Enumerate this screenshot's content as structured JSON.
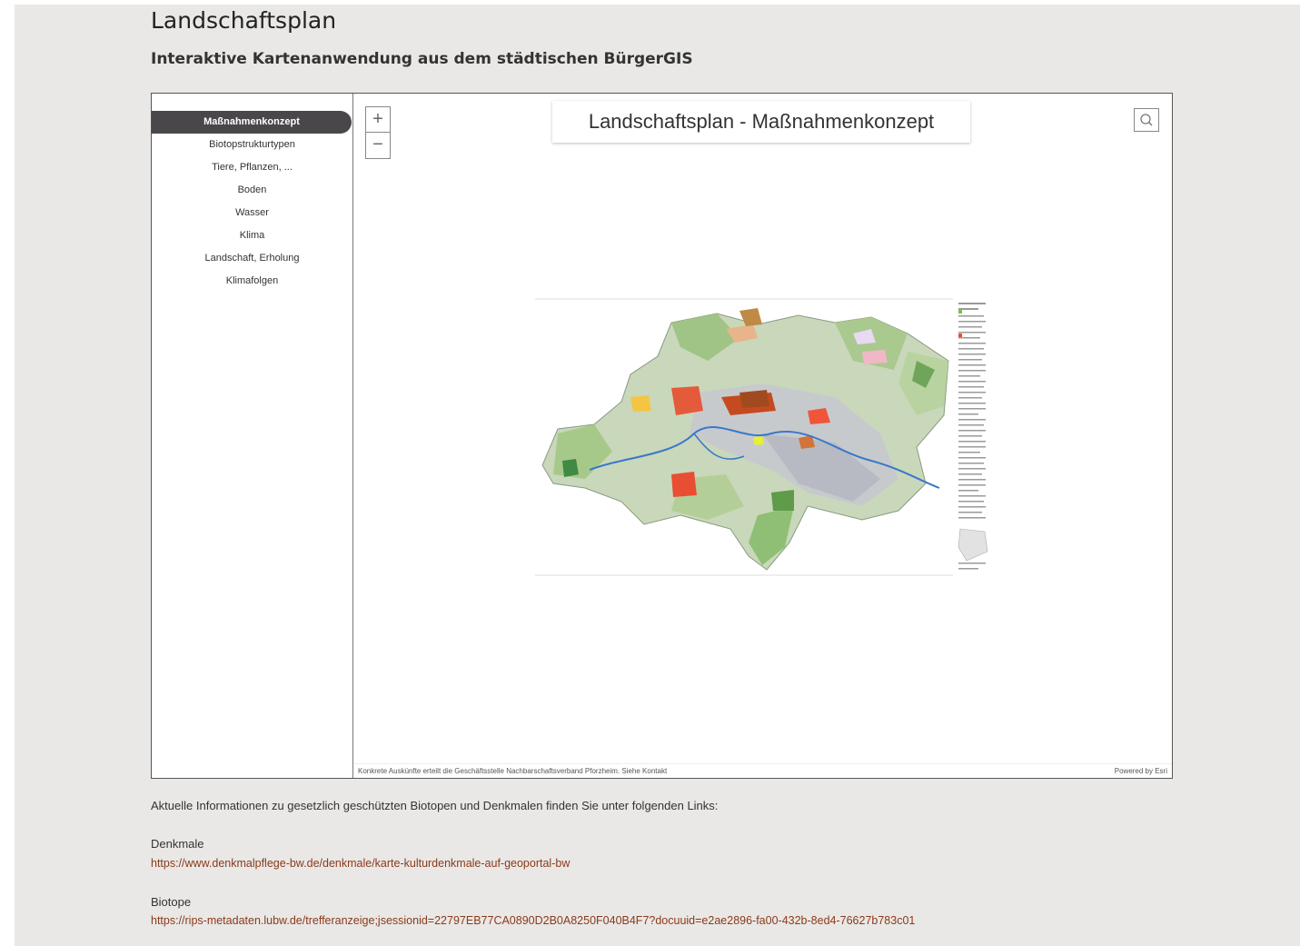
{
  "page": {
    "title": "Landschaftsplan",
    "subtitle": "Interaktive Kartenanwendung aus dem städtischen BürgerGIS"
  },
  "sidebar": {
    "tabs": [
      {
        "label": "Maßnahmenkonzept",
        "active": true
      },
      {
        "label": "Biotopstrukturtypen",
        "active": false
      },
      {
        "label": "Tiere, Pflanzen, ...",
        "active": false
      },
      {
        "label": "Boden",
        "active": false
      },
      {
        "label": "Wasser",
        "active": false
      },
      {
        "label": "Klima",
        "active": false
      },
      {
        "label": "Landschaft, Erholung",
        "active": false
      },
      {
        "label": "Klimafolgen",
        "active": false
      }
    ]
  },
  "map": {
    "title": "Landschaftsplan - Maßnahmenkonzept",
    "zoom_in": "+",
    "zoom_out": "−",
    "attribution": "Konkrete Auskünfte erteilt die Geschäftsstelle Nachbarschaftsverband Pforzheim. Siehe Kontakt",
    "powered_by": "Powered by Esri",
    "icons": [
      "search-icon",
      "plus-icon",
      "minus-icon",
      "collapse-arrow-icon"
    ]
  },
  "info": {
    "text": "Aktuelle Informationen zu gesetzlich geschützten Biotopen und Denkmalen finden Sie unter folgenden Links:",
    "denkmale_label": "Denkmale",
    "denkmale_url": "https://www.denkmalpflege-bw.de/denkmale/karte-kulturdenkmale-auf-geoportal-bw",
    "biotope_label": "Biotope",
    "biotope_url": "https://rips-metadaten.lubw.de/trefferanzeige;jsessionid=22797EB77CA0890D2B0A8250F040B4F7?docuuid=e2ae2896-fa00-432b-8ed4-76627b783c01"
  },
  "colors": {
    "active_tab": "#4a474a",
    "handle": "#8b2810",
    "link": "#8b3a1a",
    "page_bg": "#e9e8e6"
  }
}
